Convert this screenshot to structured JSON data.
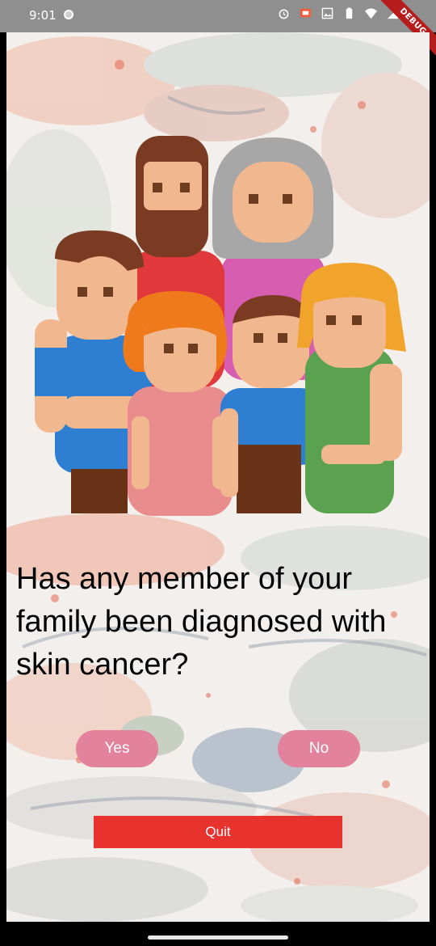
{
  "status_bar": {
    "time": "9:01",
    "icons": [
      "alarm-icon",
      "cast-icon",
      "image-icon",
      "battery-icon",
      "wifi-icon",
      "signal-icon"
    ],
    "debug_label": "DEBUG"
  },
  "question": {
    "text": "Has any member of your family been diagnosed with skin cancer?"
  },
  "buttons": {
    "yes_label": "Yes",
    "no_label": "No",
    "quit_label": "Quit"
  },
  "illustration": {
    "name": "family-illustration"
  },
  "colors": {
    "pill_button": "#e2829c",
    "quit_button": "#e8322e",
    "status_bar": "#8f8f8f"
  }
}
